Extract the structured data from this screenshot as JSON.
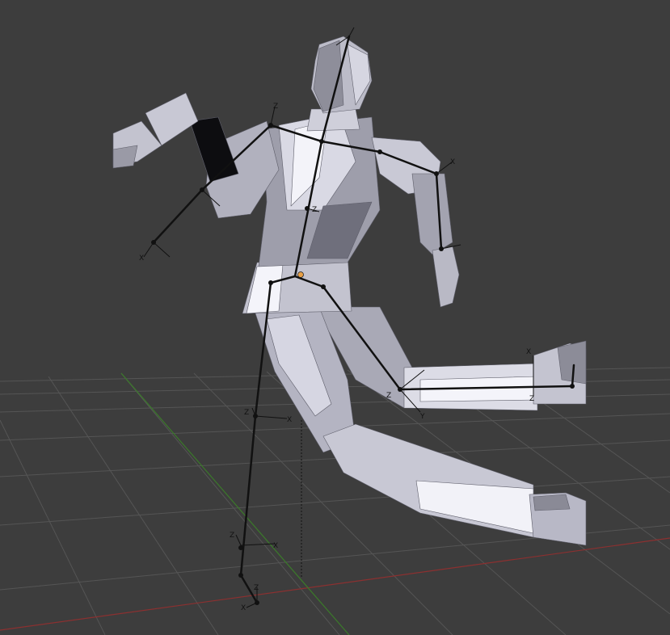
{
  "viewport": {
    "background": "#3d3d3d",
    "grid_color": "#555555",
    "axis_x_color": "#9a3434",
    "axis_y_color": "#3b7a2a",
    "mesh_light": "#e6e6ee",
    "mesh_mid": "#b7b7c4",
    "mesh_dark": "#7b7b88",
    "bone_color": "#111111",
    "origin_color": "#e8a046"
  },
  "axis_labels": {
    "x": "X",
    "y": "Y",
    "z": "Z"
  }
}
